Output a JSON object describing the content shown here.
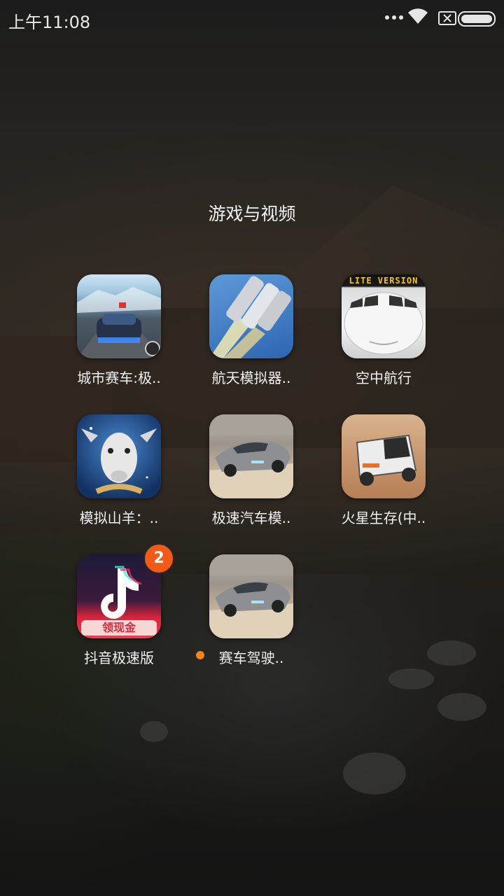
{
  "status_bar": {
    "time": "上午11:08",
    "icons": [
      "more-dots-icon",
      "wifi-icon",
      "no-sim-icon",
      "battery-icon"
    ]
  },
  "folder": {
    "title": "游戏与视频"
  },
  "apps": [
    {
      "label": "城市赛车:极..",
      "icon": "city-racing-icon"
    },
    {
      "label": "航天模拟器..",
      "icon": "space-rocket-icon"
    },
    {
      "label": "空中航行",
      "icon": "airplane-icon",
      "icon_text": "LITE VERSION"
    },
    {
      "label": "模拟山羊：..",
      "icon": "goat-icon"
    },
    {
      "label": "极速汽车模..",
      "icon": "sports-car-icon"
    },
    {
      "label": "火星生存(中..",
      "icon": "mars-rover-icon"
    },
    {
      "label": "抖音极速版",
      "icon": "douyin-icon",
      "badge": "2",
      "icon_text": "领现金"
    },
    {
      "label": "赛车驾驶..",
      "icon": "sports-car-icon",
      "new_indicator": true
    }
  ],
  "colors": {
    "badge": "#f25a17",
    "new_dot": "#f0851c"
  }
}
